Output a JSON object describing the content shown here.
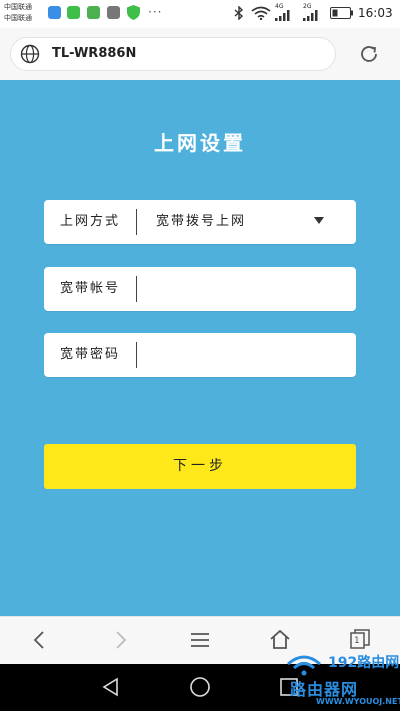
{
  "status_bar": {
    "carrier_line1": "中国联通",
    "carrier_line2": "中国联通",
    "more": "···",
    "net1": "4G",
    "net2": "2G",
    "time": "16:03"
  },
  "browser": {
    "url": "TL-WR886N",
    "globe_icon": "globe-icon",
    "reload_icon": "reload-icon"
  },
  "page": {
    "title": "上网设置",
    "connection_type": {
      "label": "上网方式",
      "value": "宽带拨号上网"
    },
    "account": {
      "label": "宽带帐号",
      "value": ""
    },
    "password": {
      "label": "宽带密码",
      "value": ""
    },
    "next_button": "下一步"
  },
  "toolbar": {
    "icons": [
      "back-icon",
      "forward-icon",
      "menu-icon",
      "home-icon",
      "tabs-icon"
    ],
    "tab_count": "1"
  },
  "android_nav": {
    "icons": [
      "nav-back-icon",
      "nav-home-icon",
      "nav-recent-icon"
    ]
  },
  "watermark": {
    "line1": "192路由网",
    "line2": "路由器网",
    "line3": "WWW.WYOUOJ.NET"
  },
  "colors": {
    "page_background": "#4fb0dc",
    "button": "#ffe81a",
    "watermark": "#2a8de0"
  }
}
